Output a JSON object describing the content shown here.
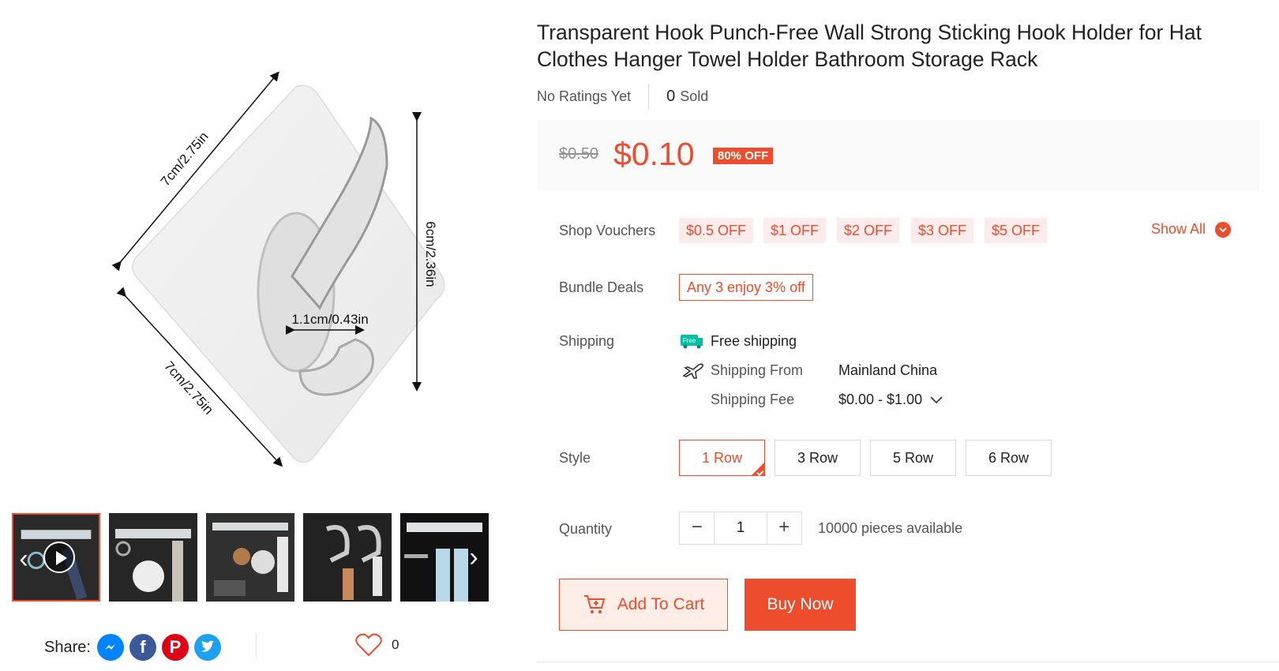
{
  "product": {
    "title": "Transparent Hook Punch-Free Wall Strong Sticking Hook Holder for Hat Clothes Hanger Towel Holder Bathroom Storage Rack",
    "ratings_text": "No Ratings Yet",
    "sold_count": "0",
    "sold_label": "Sold"
  },
  "image": {
    "dim_top": "7cm/2.75in",
    "dim_bottom": "7cm/2.75in",
    "dim_right": "6cm/2.36in",
    "dim_hook": "1.1cm/0.43in"
  },
  "pricing": {
    "original": "$0.50",
    "current": "$0.10",
    "discount": "80% OFF",
    "accent_color": "#ee4d2d"
  },
  "vouchers": {
    "label": "Shop Vouchers",
    "items": [
      "$0.5 OFF",
      "$1 OFF",
      "$2 OFF",
      "$3 OFF",
      "$5 OFF"
    ],
    "show_all": "Show All"
  },
  "bundle": {
    "label": "Bundle Deals",
    "deal": "Any 3 enjoy 3% off"
  },
  "shipping": {
    "label": "Shipping",
    "free_badge": "Free",
    "free_text": "Free shipping",
    "from_label": "Shipping From",
    "from_value": "Mainland China",
    "fee_label": "Shipping Fee",
    "fee_value": "$0.00 - $1.00"
  },
  "style": {
    "label": "Style",
    "options": [
      "1 Row",
      "3 Row",
      "5 Row",
      "6 Row"
    ],
    "selected": "1 Row"
  },
  "quantity": {
    "label": "Quantity",
    "value": "1",
    "minus": "−",
    "plus": "+",
    "available": "10000 pieces available"
  },
  "actions": {
    "add_to_cart": "Add To Cart",
    "buy_now": "Buy Now"
  },
  "share": {
    "label": "Share:",
    "icons": [
      "messenger-icon",
      "facebook-icon",
      "pinterest-icon",
      "twitter-icon"
    ],
    "like_count": "0"
  }
}
